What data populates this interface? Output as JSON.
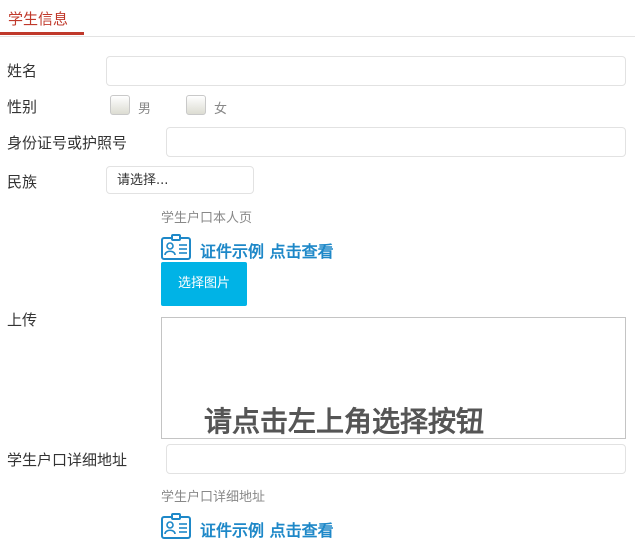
{
  "tab": {
    "label": "学生信息"
  },
  "form": {
    "name_label": "姓名",
    "gender_label": "性别",
    "gender_options": [
      "男",
      "女"
    ],
    "id_label": "身份证号或护照号",
    "ethnic_label": "民族",
    "ethnic_selected": "请选择...",
    "hukou_hint": "学生户口本人页",
    "example_link": "证件示例 点击查看",
    "choose_button": "选择图片",
    "upload_label": "上传",
    "upload_placeholder": "请点击左上角选择按钮",
    "address_label": "学生户口详细地址",
    "address_hint": "学生户口详细地址",
    "example_link_2": "证件示例 点击查看"
  },
  "colors": {
    "accent": "#c0392b",
    "button": "#00b3e6",
    "link": "#1e88c8"
  },
  "icons": [
    "id-card-icon"
  ]
}
